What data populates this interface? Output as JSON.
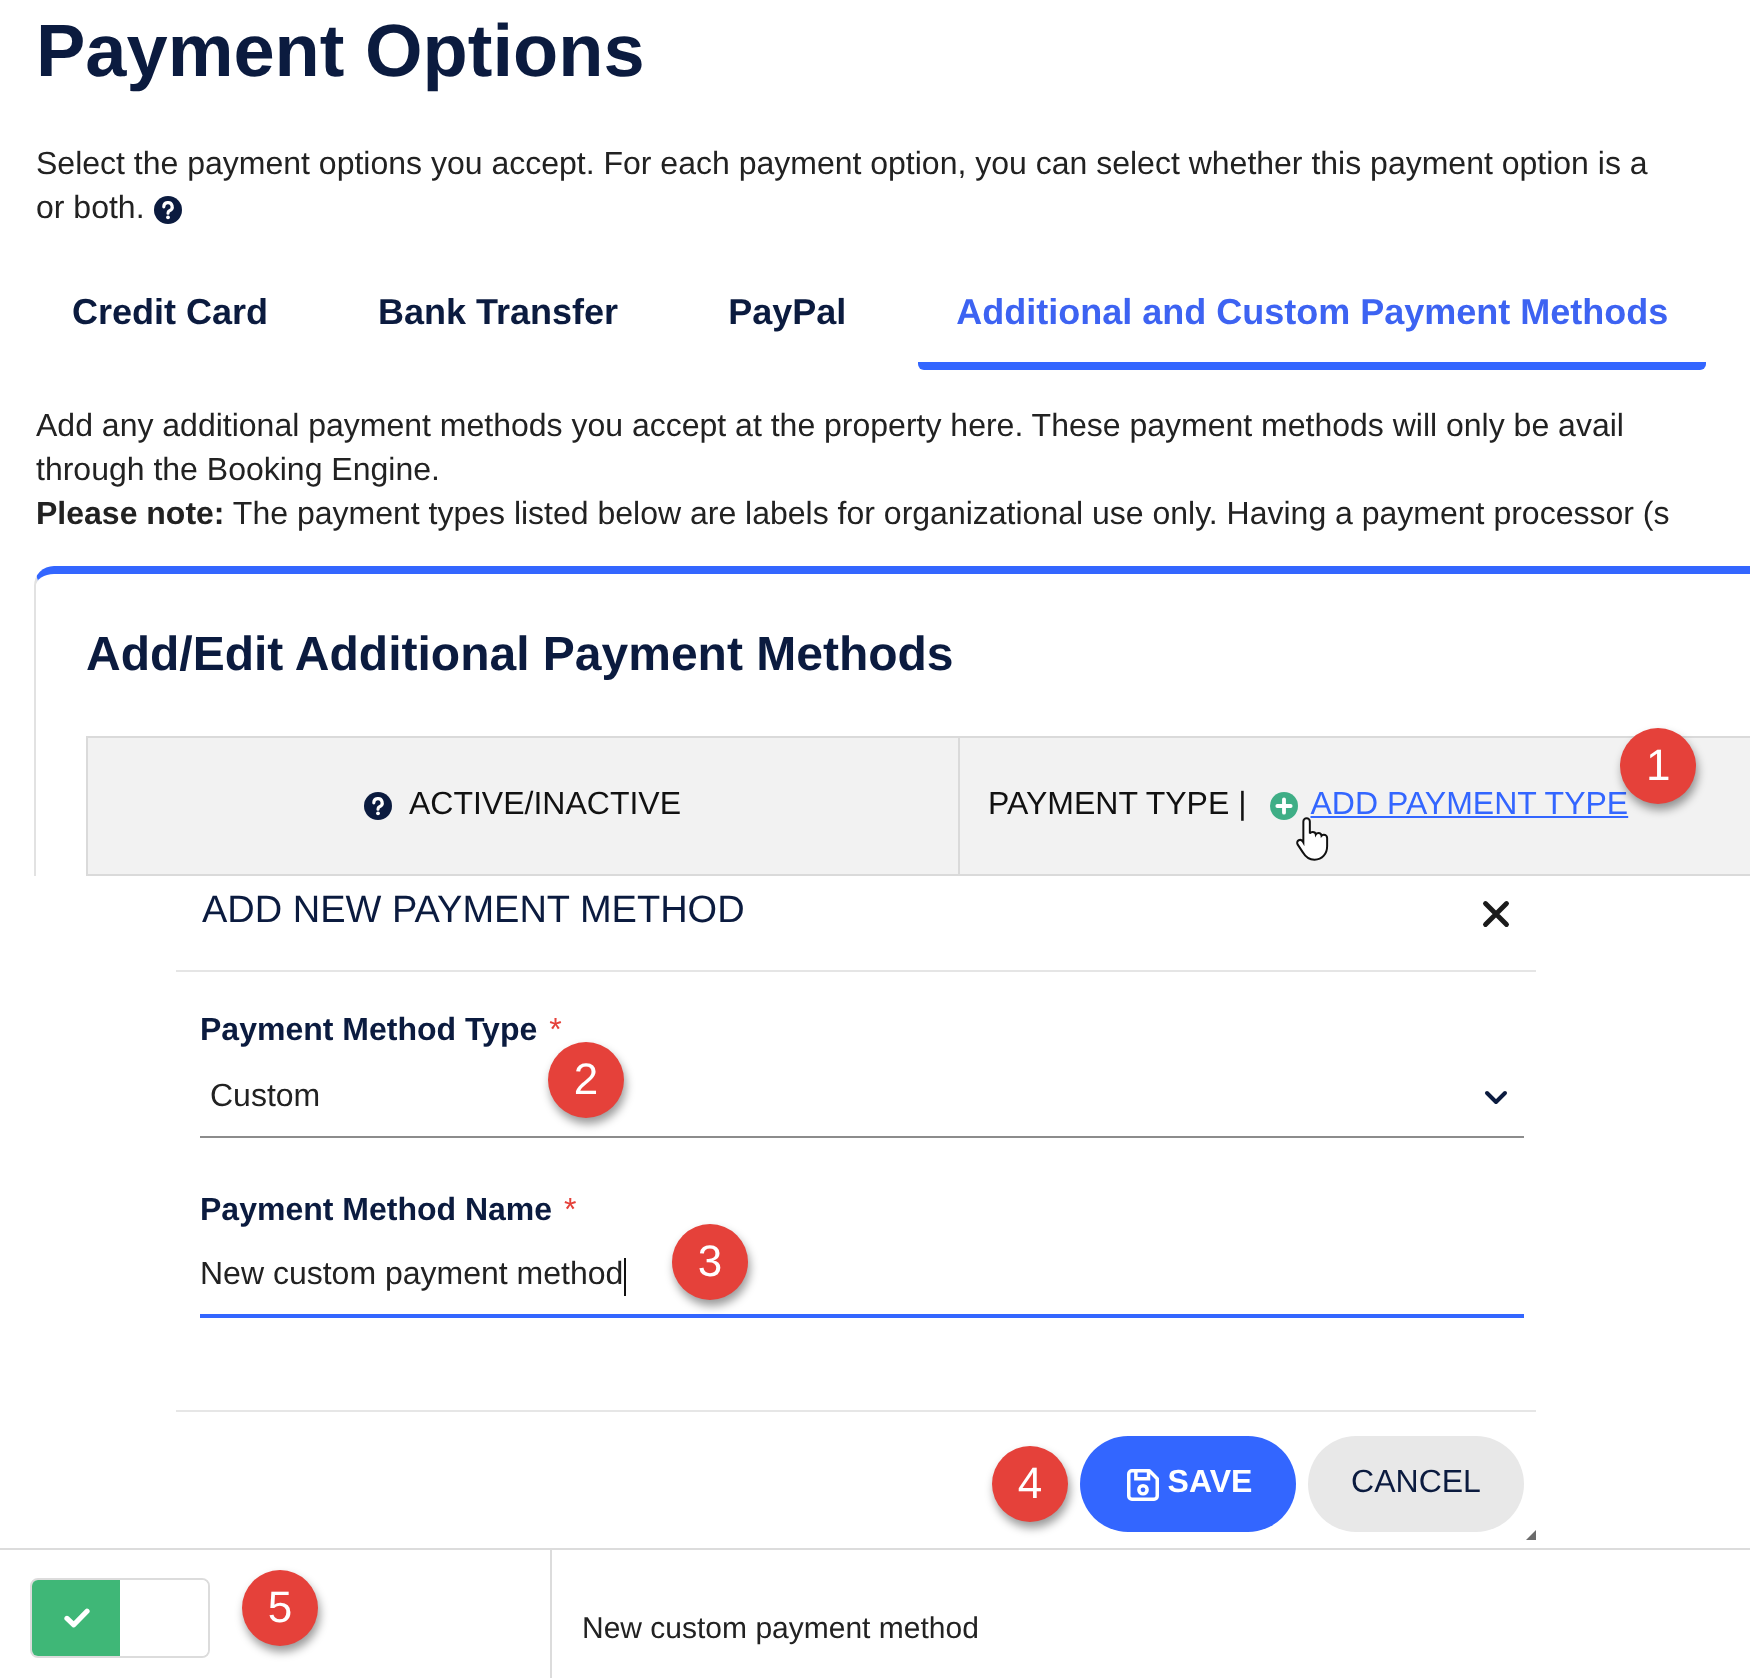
{
  "page": {
    "title": "Payment Options",
    "intro_lines": [
      "Select the payment options you accept. For each payment option, you can select whether this payment option is a",
      "or both."
    ]
  },
  "tabs": [
    {
      "label": "Credit Card",
      "selected": false
    },
    {
      "label": "Bank Transfer",
      "selected": false
    },
    {
      "label": "PayPal",
      "selected": false
    },
    {
      "label": "Additional and Custom Payment Methods",
      "selected": true
    }
  ],
  "tab_panel": {
    "description_lines": [
      "Add any additional payment methods you accept at the property here. These payment methods will only be avail",
      "through the Booking Engine."
    ],
    "note": "**Please note:** The payment types listed below are labels for organizational use only. Having a payment processor (s"
  },
  "card": {
    "title": "Add/Edit Additional Payment Methods",
    "table": {
      "columns": [
        {
          "label": "ACTIVE/INACTIVE",
          "info_icon": true
        },
        {
          "label": "PAYMENT TYPE |",
          "info_icon": false,
          "link": "ADD PAYMENT TYPE",
          "marker": "1"
        }
      ]
    }
  },
  "dialog": {
    "title": "ADD NEW PAYMENT METHOD",
    "fields": [
      {
        "kind": "select",
        "label": "Payment Method Type",
        "required_mark": "*",
        "value": "Custom",
        "focused": false,
        "marker": "2"
      },
      {
        "kind": "text",
        "label": "Payment Method Name",
        "required_mark": "*",
        "value": "New custom payment method",
        "focused": true,
        "marker": "3"
      }
    ],
    "buttons": [
      {
        "kind": "primary",
        "label": "SAVE",
        "marker": "4"
      },
      {
        "kind": "secondary",
        "label": "CANCEL"
      }
    ]
  },
  "table_rows": [
    {
      "active": true,
      "payment_type": "New custom payment method",
      "marker": "5"
    }
  ]
}
